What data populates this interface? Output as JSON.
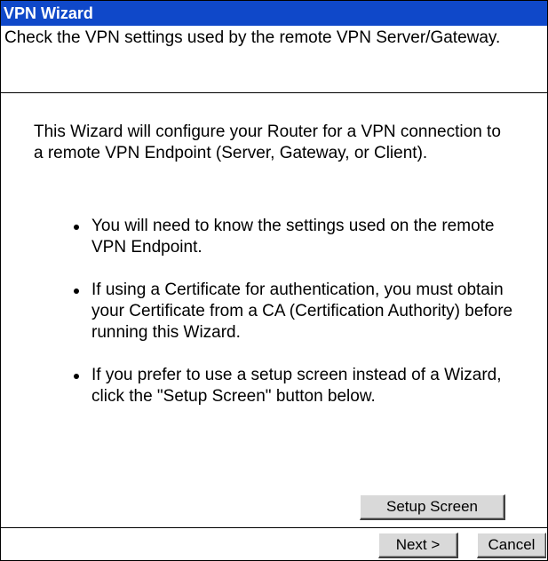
{
  "wizard": {
    "title": "VPN Wizard",
    "subtitle": "Check the VPN settings used by the remote VPN Server/Gateway.",
    "intro": "This Wizard will configure your Router for a VPN connection to a remote VPN Endpoint (Server, Gateway, or Client).",
    "bullets": [
      "You will need to know the settings used on the remote VPN Endpoint.",
      "If using a Certificate for authentication, you must obtain your Certificate from a CA (Certification Authority) before running this Wizard.",
      "If you prefer to use a setup screen instead of a Wizard, click the \"Setup Screen\" button below."
    ],
    "setup_button_label": "Setup Screen",
    "next_button_label": "Next >",
    "cancel_button_label": "Cancel"
  },
  "colors": {
    "title_bar": "#0f48c9",
    "button_face": "#d9d9d9"
  }
}
